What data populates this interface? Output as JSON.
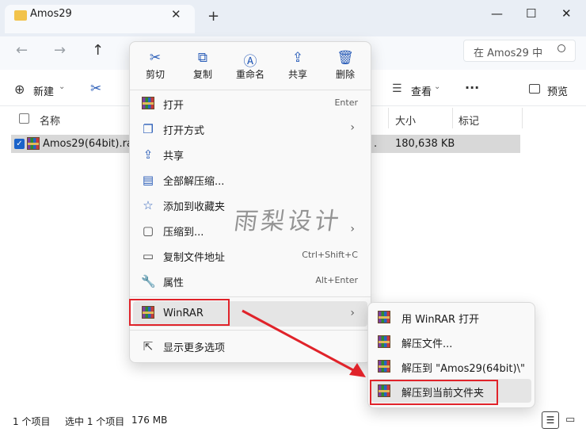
{
  "window": {
    "tab_title": "Amos29",
    "tab_close": "✕",
    "new_tab": "+",
    "minimize": "—",
    "maximize": "☐",
    "close": "✕"
  },
  "nav": {
    "back": "←",
    "forward": "→",
    "up": "↑",
    "search_placeholder": "在 Amos29 中",
    "search_icon": "search-icon"
  },
  "toolbar": {
    "new_label": "新建",
    "view_label": "查看",
    "more": "···",
    "preview_label": "预览"
  },
  "columns": {
    "name": "名称",
    "size": "大小",
    "tag": "标记"
  },
  "file": {
    "name": "Amos29(64bit).rar",
    "date_tail": ".",
    "size": "180,638 KB"
  },
  "status": {
    "count": "1 个项目",
    "selected": "选中 1 个项目",
    "size": "176 MB"
  },
  "context_menu": {
    "quick_actions": [
      {
        "label": "剪切",
        "icon": "cut-icon"
      },
      {
        "label": "复制",
        "icon": "copy-icon"
      },
      {
        "label": "重命名",
        "icon": "rename-icon"
      },
      {
        "label": "共享",
        "icon": "share-icon"
      },
      {
        "label": "删除",
        "icon": "delete-icon"
      }
    ],
    "items": [
      {
        "label": "打开",
        "shortcut": "Enter"
      },
      {
        "label": "打开方式",
        "arrow": "›"
      },
      {
        "label": "共享"
      },
      {
        "label": "全部解压缩..."
      },
      {
        "label": "添加到收藏夹"
      },
      {
        "label": "压缩到...",
        "arrow": "›"
      },
      {
        "label": "复制文件地址",
        "shortcut": "Ctrl+Shift+C"
      },
      {
        "label": "属性",
        "shortcut": "Alt+Enter"
      },
      {
        "label": "WinRAR",
        "arrow": "›"
      },
      {
        "label": "显示更多选项"
      }
    ]
  },
  "submenu": {
    "items": [
      {
        "label": "用 WinRAR 打开"
      },
      {
        "label": "解压文件..."
      },
      {
        "label": "解压到 \"Amos29(64bit)\\\""
      },
      {
        "label": "解压到当前文件夹"
      }
    ]
  },
  "watermark": "雨梨设计",
  "colors": {
    "highlight_red": "#e0232a",
    "accent_blue": "#2a5db8"
  }
}
